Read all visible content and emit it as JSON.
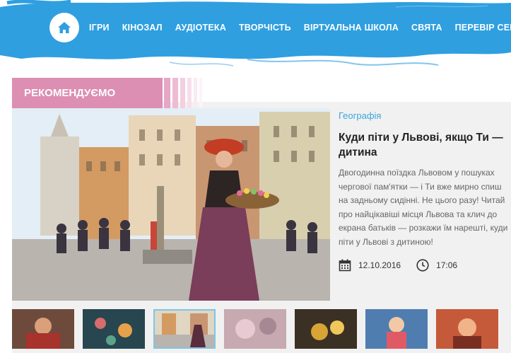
{
  "nav": {
    "home_icon": "home-icon",
    "items": [
      {
        "label": "ІГРИ"
      },
      {
        "label": "КІНОЗАЛ"
      },
      {
        "label": "АУДІОТЕКА"
      },
      {
        "label": "ТВОРЧІСТЬ"
      },
      {
        "label": "ВІРТУАЛЬНА ШКОЛА"
      },
      {
        "label": "СВЯТА"
      },
      {
        "label": "ПЕРЕВІР СЕБЕ"
      }
    ],
    "accent_color": "#2f9fe0"
  },
  "recommended": {
    "heading": "РЕКОМЕНДУЄМО",
    "tab_color": "#dd8eb3"
  },
  "article": {
    "category": "Географія",
    "title": "Куди піти у Львові, якщо Ти — дитина",
    "excerpt": "Двогодинна поїздка Львовом у пошуках чергової пам'ятки — і Ти вже мирно спиш на задньому сидінні. Не цього разу! Читай про найцікавіші місця Львова та клич до екрана батьків — розкажи їм нарешті, куди піти у Львові з дитиною!",
    "date": "12.10.2016",
    "time": "17:06",
    "date_icon": "calendar-icon",
    "time_icon": "clock-icon"
  },
  "thumbnails": {
    "count": 7,
    "active_index": 2
  }
}
